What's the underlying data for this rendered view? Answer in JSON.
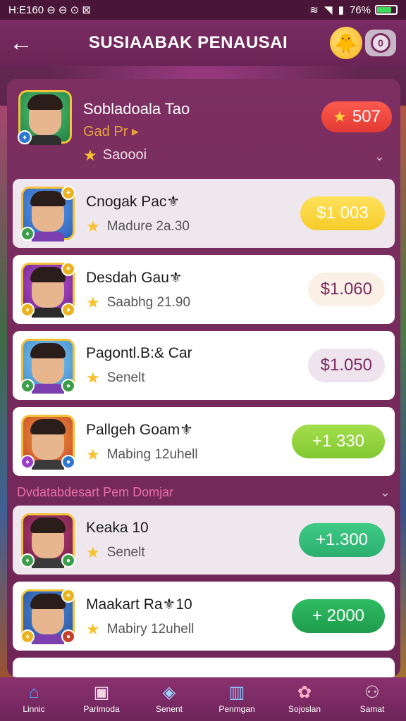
{
  "status_bar": {
    "time_text": "H:E160 ⊖ ⊖ ⊙ ⊠",
    "battery_text": "76%"
  },
  "header": {
    "title": "SUSIAABAK PENAUSAI",
    "coin_symbol": "0"
  },
  "featured": {
    "name": "Sobladoala Tao",
    "subtitle": "Gad Pr ▸",
    "meta": "Saoooi",
    "score": "507"
  },
  "rows_top": [
    {
      "name": "Cnogak Pac⚜",
      "meta": "Madure 2a.30",
      "value": "$1 003",
      "pill": "yellow",
      "bg": "tinted"
    },
    {
      "name": "Desdah Gau⚜",
      "meta": "Saabhg 21.90",
      "value": "$1.060",
      "pill": "cream",
      "bg": "white"
    },
    {
      "name": "Pagontl.B:& Car",
      "meta": "Senelt",
      "value": "$1.050",
      "pill": "lav",
      "bg": "white"
    },
    {
      "name": "Pallgeh Goam⚜",
      "meta": "Mabing 12uhell",
      "value": "+1 330",
      "pill": "lime",
      "bg": "white"
    }
  ],
  "section_title": "Dvdatabdesart Pem Domjar",
  "rows_bottom": [
    {
      "name": "Keaka 10",
      "meta": "Senelt",
      "value": "+1.300",
      "pill": "teal",
      "bg": "tinted"
    },
    {
      "name": "Maakart Ra⚜10",
      "meta": "Mabiry 12uhell",
      "value": "+ 2000",
      "pill": "green",
      "bg": "white"
    }
  ],
  "bottom_nav": [
    {
      "label": "Linnic",
      "icon": "home-icon"
    },
    {
      "label": "Parimoda",
      "icon": "shop-icon"
    },
    {
      "label": "Senent",
      "icon": "box-icon"
    },
    {
      "label": "Penmgan",
      "icon": "chart-icon"
    },
    {
      "label": "Sojoslan",
      "icon": "settings-icon"
    },
    {
      "label": "Samat",
      "icon": "users-icon"
    }
  ],
  "colors": {
    "brand": "#7a2c63",
    "accent_red": "#e13a33",
    "section_pink": "#e86fa6"
  }
}
